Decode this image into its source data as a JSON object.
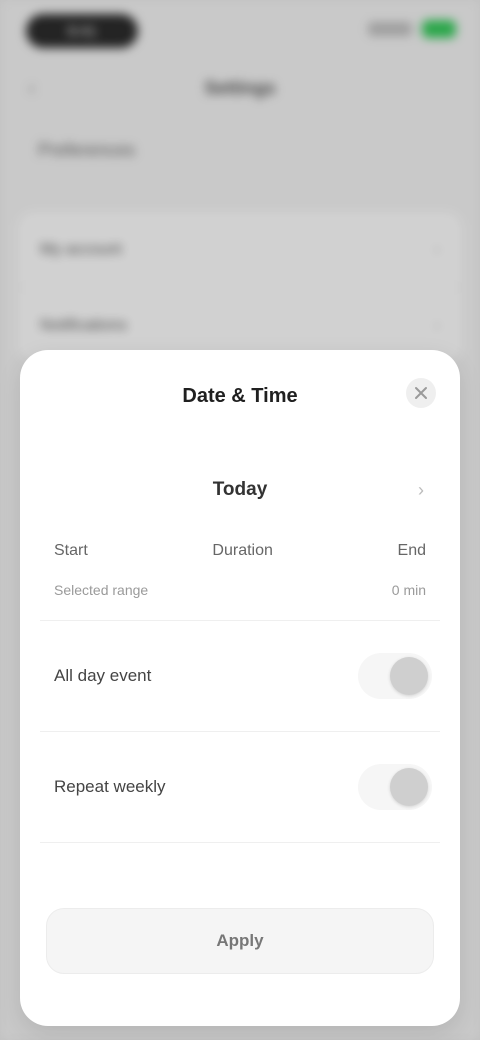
{
  "status": {
    "time": "9:41"
  },
  "app": {
    "title": "Settings",
    "section": "Preferences",
    "rows": [
      {
        "label": "My account"
      },
      {
        "label": "Notifications"
      }
    ]
  },
  "sheet": {
    "title": "Date & Time",
    "date_label": "Today",
    "cols": {
      "left": "Start",
      "center": "Duration",
      "right": "End"
    },
    "sub": {
      "left": "Selected range",
      "right": "0 min"
    },
    "toggles": [
      {
        "label": "All day event",
        "on": true
      },
      {
        "label": "Repeat weekly",
        "on": true
      }
    ],
    "apply_label": "Apply"
  },
  "colors": {
    "accent": "#34c759",
    "sheet_bg": "#ffffff",
    "dim": "rgba(0,0,0,0.16)"
  },
  "icons": {
    "close": "close-icon",
    "back": "chevron-left-icon",
    "chevron": "chevron-right-icon"
  }
}
